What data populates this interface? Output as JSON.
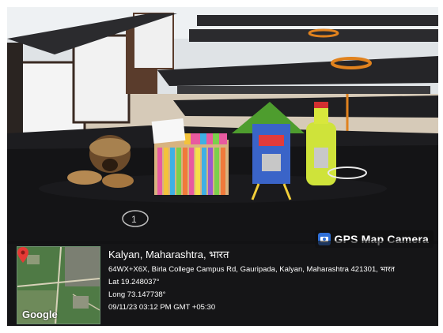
{
  "watermark": {
    "app_name": "GPS Map Camera",
    "app_icon": "camera-icon"
  },
  "location": {
    "title": "Kalyan, Maharashtra, भारत",
    "address": "64WX+X6X, Birla College Campus Rd, Gauripada, Kalyan, Maharashtra 421301, भारत",
    "latitude": "Lat 19.248037°",
    "longitude": "Long 73.147738°",
    "timestamp": "09/11/23 03:12 PM GMT +05:30"
  },
  "map": {
    "provider": "Google",
    "pin_icon": "map-pin-icon"
  },
  "scene": {
    "description_objects": [
      "coconut-shell-craft",
      "ice-cream-stick-pen-stand",
      "house-bird-feeder",
      "bottle-craft"
    ],
    "colors": {
      "table": "#141416",
      "floor": "#d8cdbd",
      "wall": "#e9ecef"
    }
  },
  "scene_marks": {
    "table_label": "1"
  }
}
